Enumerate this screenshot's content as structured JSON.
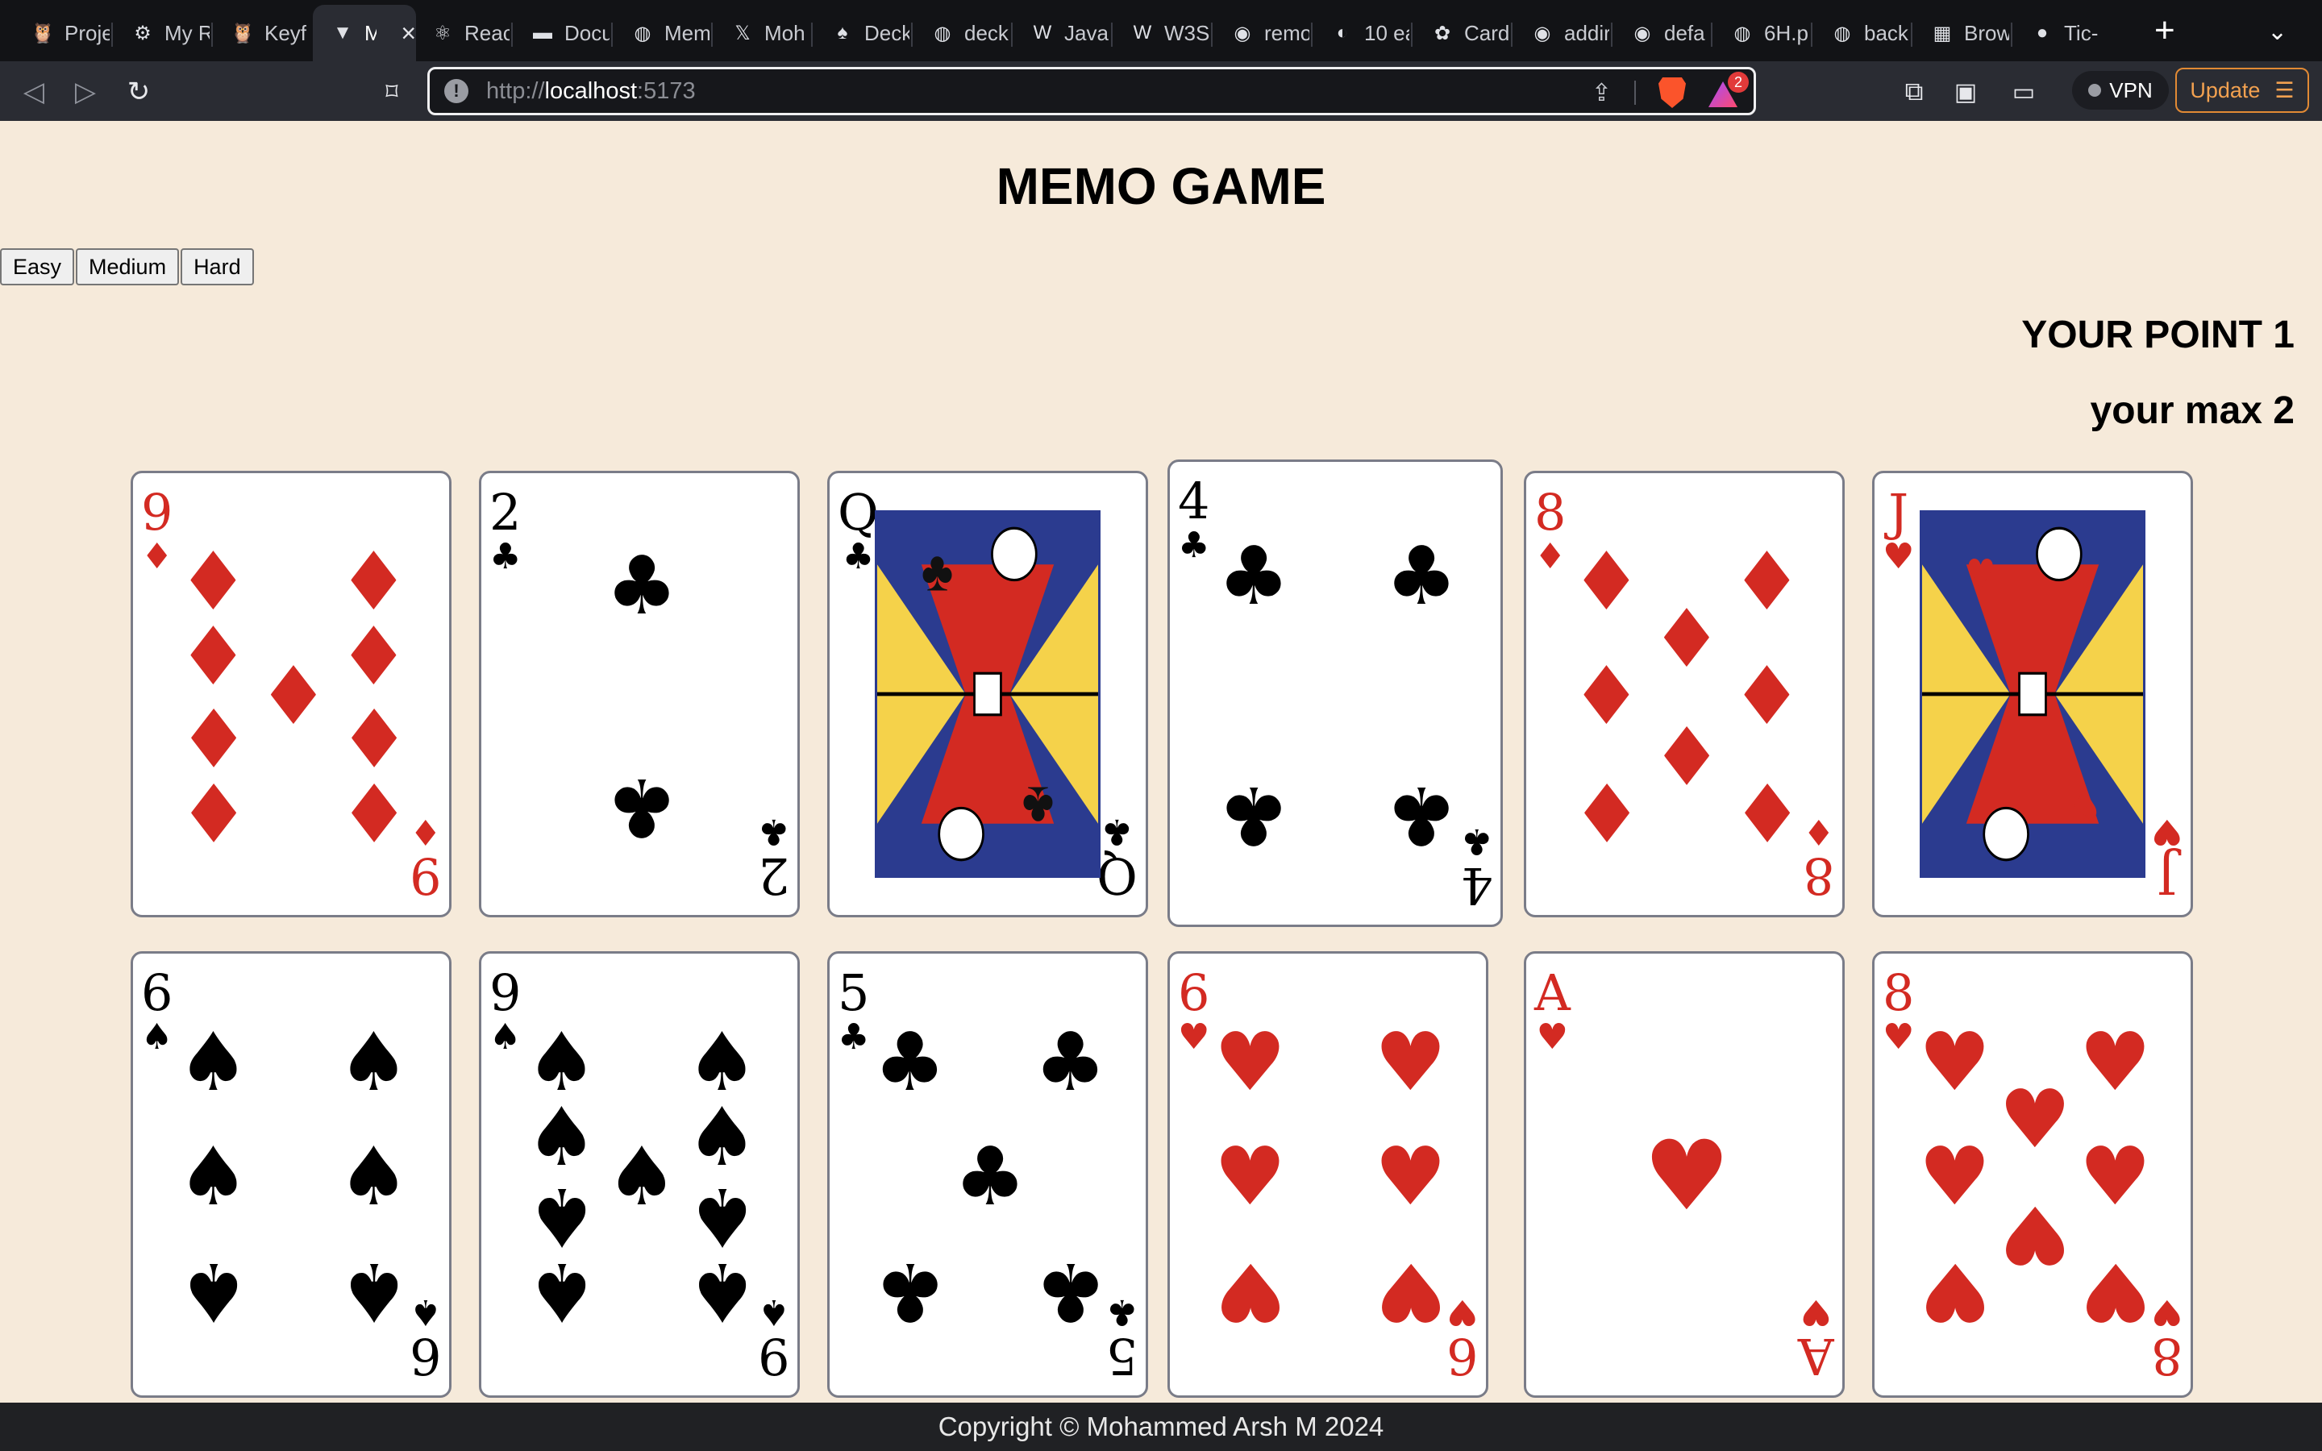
{
  "browser": {
    "tabs": [
      {
        "title": "Proje",
        "icon": "🦉"
      },
      {
        "title": "My R",
        "icon": "⚙"
      },
      {
        "title": "Keyf",
        "icon": "🦉"
      },
      {
        "title": "M",
        "icon": "▼",
        "active": true
      },
      {
        "title": "Reac",
        "icon": "⚛"
      },
      {
        "title": "Docu",
        "icon": "▬"
      },
      {
        "title": "Mem",
        "icon": "◍"
      },
      {
        "title": "Moh",
        "icon": "𝕏"
      },
      {
        "title": "Deck",
        "icon": "♠"
      },
      {
        "title": "deck",
        "icon": "◍"
      },
      {
        "title": "Java",
        "icon": "W"
      },
      {
        "title": "W3S",
        "icon": "W"
      },
      {
        "title": "remo",
        "icon": "◉"
      },
      {
        "title": "10 ea",
        "icon": "◐"
      },
      {
        "title": "Card",
        "icon": "✿"
      },
      {
        "title": "addir",
        "icon": "◉"
      },
      {
        "title": "defa",
        "icon": "◉"
      },
      {
        "title": "6H.p",
        "icon": "◍"
      },
      {
        "title": "back",
        "icon": "◍"
      },
      {
        "title": "Brow",
        "icon": "▦"
      },
      {
        "title": "Tic-",
        "icon": "●"
      }
    ],
    "url_scheme": "http://",
    "url_host": "localhost",
    "url_rest": ":5173",
    "rewards_badge": "2",
    "vpn_label": "VPN",
    "update_label": "Update"
  },
  "game": {
    "title": "MEMO GAME",
    "difficulty": [
      "Easy",
      "Medium",
      "Hard"
    ],
    "score_text": "YOUR POINT 1",
    "max_text": "your max 2"
  },
  "cards": [
    {
      "rank": "9",
      "suit": "♦",
      "color": "red"
    },
    {
      "rank": "2",
      "suit": "♣",
      "color": "black"
    },
    {
      "rank": "Q",
      "suit": "♣",
      "color": "black",
      "face": true
    },
    {
      "rank": "4",
      "suit": "♣",
      "color": "black",
      "lifted": true
    },
    {
      "rank": "8",
      "suit": "♦",
      "color": "red"
    },
    {
      "rank": "J",
      "suit": "♥",
      "color": "red",
      "face": true
    },
    {
      "rank": "6",
      "suit": "♠",
      "color": "black"
    },
    {
      "rank": "9",
      "suit": "♠",
      "color": "black"
    },
    {
      "rank": "5",
      "suit": "♣",
      "color": "black"
    },
    {
      "rank": "6",
      "suit": "♥",
      "color": "red"
    },
    {
      "rank": "A",
      "suit": "♥",
      "color": "red"
    },
    {
      "rank": "8",
      "suit": "♥",
      "color": "red"
    }
  ],
  "footer": "Copyright © Mohammed Arsh M 2024"
}
